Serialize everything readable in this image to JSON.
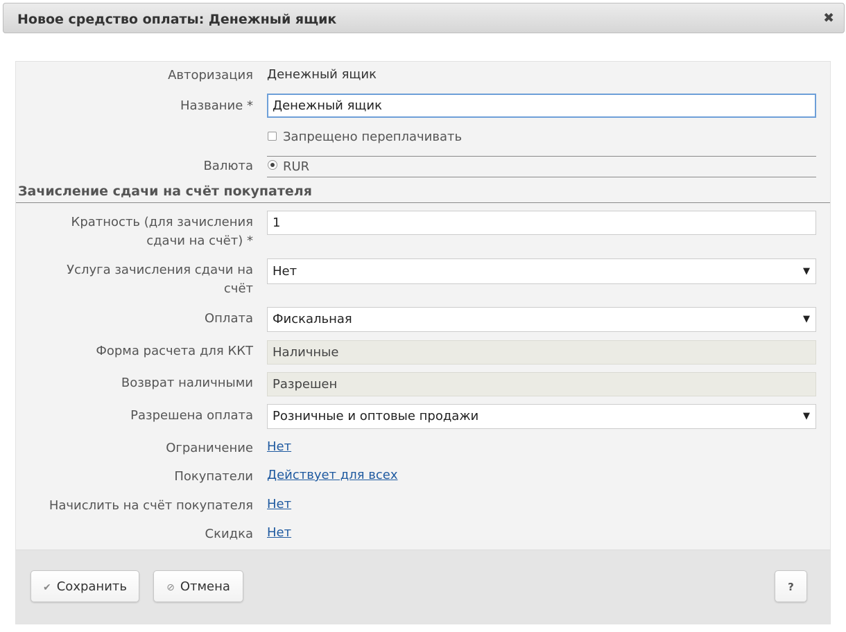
{
  "dialog": {
    "title": "Новое средство оплаты: Денежный ящик",
    "close_glyph": "✖"
  },
  "form": {
    "auth": {
      "label": "Авторизация",
      "value": "Денежный ящик"
    },
    "name": {
      "label": "Название *",
      "value": "Денежный ящик"
    },
    "overpay": {
      "label": "Запрещено переплачивать",
      "checked": false
    },
    "currency": {
      "label": "Валюта",
      "value": "RUR",
      "selected": true
    },
    "section_title": "Зачисление сдачи на счёт покупателя",
    "multiplicity": {
      "label_line1": "Кратность (для зачисления",
      "label_line2": "сдачи на счёт) *",
      "value": "1"
    },
    "change_service": {
      "label_line1": "Услуга зачисления сдачи на",
      "label_line2": "счёт",
      "value": "Нет"
    },
    "payment": {
      "label": "Оплата",
      "value": "Фискальная"
    },
    "kkt_form": {
      "label": "Форма расчета для ККТ",
      "value": "Наличные"
    },
    "cash_return": {
      "label": "Возврат наличными",
      "value": "Разрешен"
    },
    "allowed_payment": {
      "label": "Разрешена оплата",
      "value": "Розничные и оптовые продажи"
    },
    "restriction": {
      "label": "Ограничение",
      "value": "Нет"
    },
    "buyers": {
      "label": "Покупатели",
      "value": "Действует для всех"
    },
    "accrue": {
      "label": "Начислить на счёт покупателя",
      "value": "Нет"
    },
    "discount": {
      "label": "Скидка",
      "value": "Нет"
    }
  },
  "footer": {
    "save_label": "Сохранить",
    "cancel_label": "Отмена",
    "help_label": "?",
    "save_icon": "check-icon",
    "cancel_icon": "cancel-icon"
  },
  "colors": {
    "link": "#1f5aa0",
    "focus_border": "#6d9fd8",
    "readonly_bg": "#ebebe4"
  }
}
